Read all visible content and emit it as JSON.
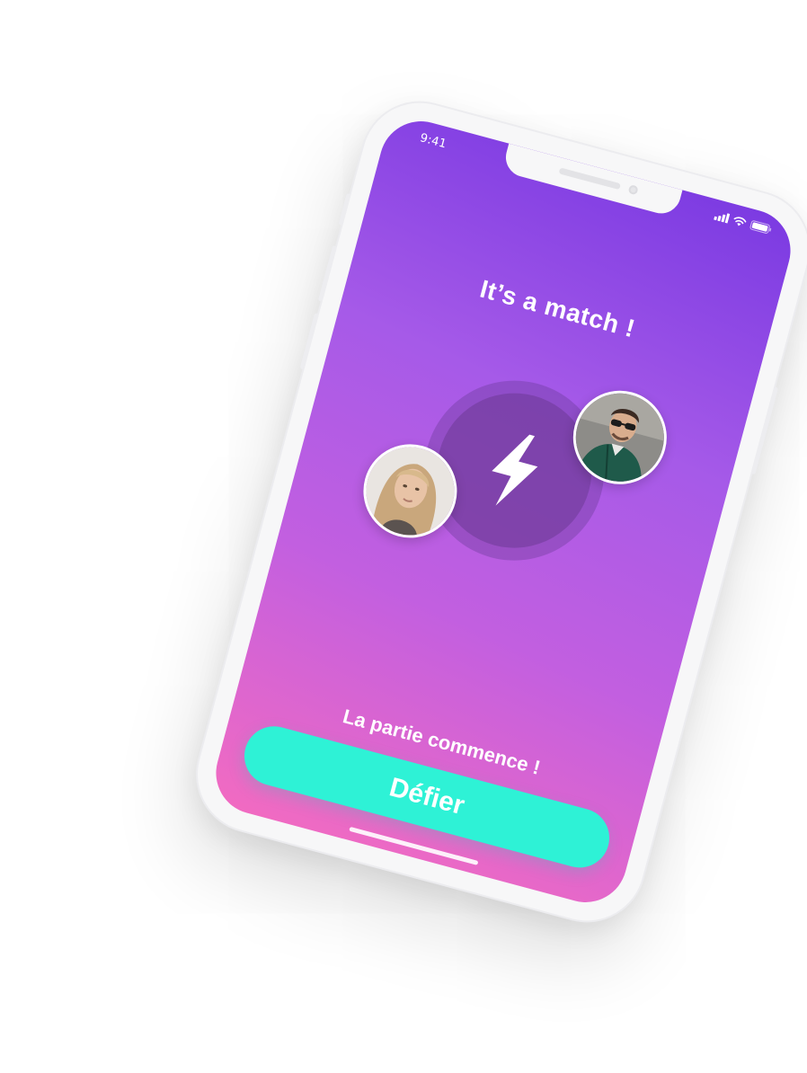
{
  "status_bar": {
    "time": "9:41",
    "icons": [
      "signal-icon",
      "wifi-icon",
      "battery-icon"
    ]
  },
  "screen": {
    "title": "It’s a match !",
    "subtitle": "La partie commence !",
    "cta_label": "Défier",
    "center_icon": "lightning-bolt-icon"
  },
  "avatars": [
    {
      "name": "avatar-left",
      "depicts": "woman-blonde-hair"
    },
    {
      "name": "avatar-right",
      "depicts": "man-sunglasses-green-jacket"
    }
  ],
  "colors": {
    "gradient_top": "#7b3ae2",
    "gradient_bottom": "#f26bc1",
    "cta_background": "#2ef2d6",
    "text": "#ffffff",
    "device_frame": "#f7f7f8"
  }
}
